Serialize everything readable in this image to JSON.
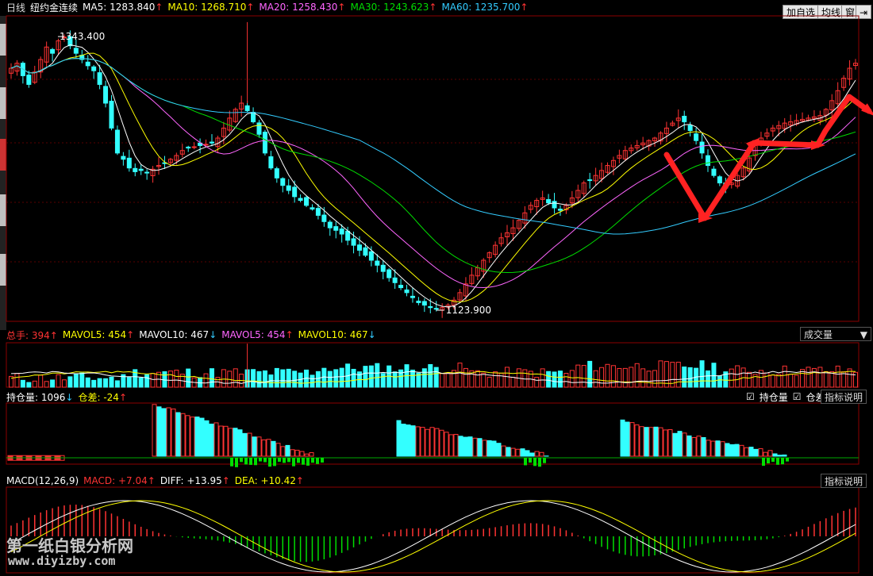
{
  "header": {
    "period": "日线",
    "symbol": "纽约金连续",
    "ma": [
      {
        "label": "MA5: 1283.840",
        "arrow": "↑",
        "color": "#ffffff"
      },
      {
        "label": "MA10: 1268.710",
        "arrow": "↑",
        "color": "#ffff00"
      },
      {
        "label": "MA20: 1258.430",
        "arrow": "↑",
        "color": "#ff66ff"
      },
      {
        "label": "MA30: 1243.623",
        "arrow": "↑",
        "color": "#00dd00"
      },
      {
        "label": "MA60: 1235.700",
        "arrow": "↑",
        "color": "#33ccff"
      }
    ],
    "buttons": {
      "add": "加自选",
      "ma": "均线",
      "win": "窗"
    }
  },
  "volume_header": {
    "total_label": "总手: 394",
    "total_arrow": "↑",
    "items": [
      {
        "label": "MAVOL5: 454",
        "arrow": "↑",
        "color": "#ffff00"
      },
      {
        "label": "MAVOL10: 467",
        "arrow": "↓",
        "color": "#ffffff"
      },
      {
        "label": "MAVOL5: 454",
        "arrow": "↑",
        "color": "#ff66ff"
      },
      {
        "label": "MAVOL10: 467",
        "arrow": "↓",
        "color": "#ffff00"
      }
    ],
    "dropdown": "成交量"
  },
  "oi_header": {
    "oi_label": "持仓量: 1096",
    "oi_arrow": "↓",
    "diff_label": "仓差: -24",
    "diff_arrow": "↑",
    "check1": "持仓量",
    "check2": "仓差",
    "help": "指标说明"
  },
  "macd_header": {
    "name": "MACD(12,26,9)",
    "macd": "MACD: +7.04",
    "macd_arrow": "↑",
    "diff": "DIFF: +13.95",
    "diff_arrow": "↑",
    "dea": "DEA: +10.42",
    "dea_arrow": "↑",
    "help": "指标说明"
  },
  "watermark": {
    "line1": "第一纸白银分析网",
    "line2": "www.diyizby.com"
  },
  "chart_data": {
    "type": "candlestick",
    "price_range": [
      1115,
      1360
    ],
    "annotations": {
      "high": "1343.400",
      "low": "1123.900"
    },
    "close": [
      1318,
      1322,
      1312,
      1305,
      1315,
      1325,
      1335,
      1330,
      1340,
      1343,
      1336,
      1330,
      1325,
      1320,
      1316,
      1305,
      1290,
      1270,
      1250,
      1245,
      1238,
      1235,
      1236,
      1234,
      1237,
      1240,
      1242,
      1245,
      1248,
      1252,
      1254,
      1255,
      1256,
      1257,
      1258,
      1262,
      1270,
      1278,
      1285,
      1290,
      1284,
      1275,
      1265,
      1250,
      1238,
      1230,
      1224,
      1220,
      1215,
      1212,
      1208,
      1205,
      1200,
      1195,
      1190,
      1188,
      1185,
      1180,
      1176,
      1172,
      1168,
      1164,
      1160,
      1155,
      1150,
      1146,
      1142,
      1138,
      1134,
      1130,
      1128,
      1126,
      1125,
      1126,
      1128,
      1132,
      1138,
      1145,
      1152,
      1158,
      1164,
      1170,
      1176,
      1182,
      1186,
      1190,
      1196,
      1202,
      1208,
      1212,
      1214,
      1210,
      1206,
      1204,
      1208,
      1214,
      1220,
      1226,
      1228,
      1232,
      1236,
      1240,
      1244,
      1248,
      1252,
      1254,
      1256,
      1258,
      1260,
      1262,
      1266,
      1270,
      1274,
      1278,
      1275,
      1268,
      1260,
      1250,
      1240,
      1232,
      1226,
      1222,
      1226,
      1232,
      1238,
      1246,
      1256,
      1262,
      1266,
      1270,
      1272,
      1274,
      1275,
      1276,
      1277,
      1278,
      1279,
      1280,
      1285,
      1292,
      1300,
      1310,
      1318,
      1322
    ],
    "ma_colors": [
      "#ffffff",
      "#ffff00",
      "#ff66ff",
      "#00dd00",
      "#33ccff"
    ],
    "volume_range": [
      0,
      1000
    ],
    "open_interest": {
      "segments": [
        [
          0,
          20
        ],
        [
          52,
          130
        ],
        [
          203,
          315
        ],
        [
          366,
          450
        ],
        [
          450,
          1060
        ]
      ]
    },
    "macd": {
      "note": "histogram with DIFF/DEA lines"
    }
  }
}
